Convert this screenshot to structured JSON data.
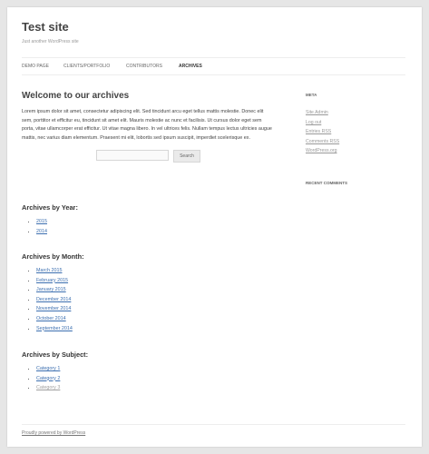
{
  "site": {
    "title": "Test site",
    "description": "Just another WordPress site"
  },
  "nav": {
    "items": [
      {
        "label": "DEMO PAGE",
        "active": false
      },
      {
        "label": "CLIENTS/PORTFOLIO",
        "active": false
      },
      {
        "label": "CONTRIBUTORS",
        "active": false
      },
      {
        "label": "ARCHIVES",
        "active": true
      }
    ]
  },
  "main": {
    "title": "Welcome to our archives",
    "intro": "Lorem ipsum dolor sit amet, consectetur adipiscing elit. Sed tincidunt arcu eget tellus mattis molestie. Donec elit sem, porttitor et efficitur eu, tincidunt sit amet elit. Mauris molestie ac nunc et facilisis. Ut cursus dolor eget sem porta, vitae ullamcorper erat efficitur. Ut vitae magna libero. In vel ultrices felis. Nullam tempus lectus ultricies augue mattis, nec varius diam elementum. Praesent mi elit, lobortis sed ipsum suscipit, imperdiet scelerisque ex.",
    "search": {
      "placeholder": "",
      "button_label": "Search"
    },
    "archives_year": {
      "heading": "Archives by Year:",
      "items": [
        "2015",
        "2014"
      ]
    },
    "archives_month": {
      "heading": "Archives by Month:",
      "items": [
        "March 2015",
        "February 2015",
        "January 2015",
        "December 2014",
        "November 2014",
        "October 2014",
        "September 2014"
      ]
    },
    "archives_subject": {
      "heading": "Archives by Subject:",
      "items": [
        "Category 1",
        "Category 2",
        "Category 3"
      ]
    }
  },
  "sidebar": {
    "meta_title": "META",
    "meta_links": [
      "Site Admin",
      "Log out",
      "Entries RSS",
      "Comments RSS",
      "WordPress.org"
    ],
    "recent_comments_title": "RECENT COMMENTS"
  },
  "footer": {
    "credit": "Proudly powered by WordPress"
  },
  "colors": {
    "link": "#3c6fb0",
    "visited_link": "#9f9f9f",
    "background": "#e6e6e6"
  }
}
